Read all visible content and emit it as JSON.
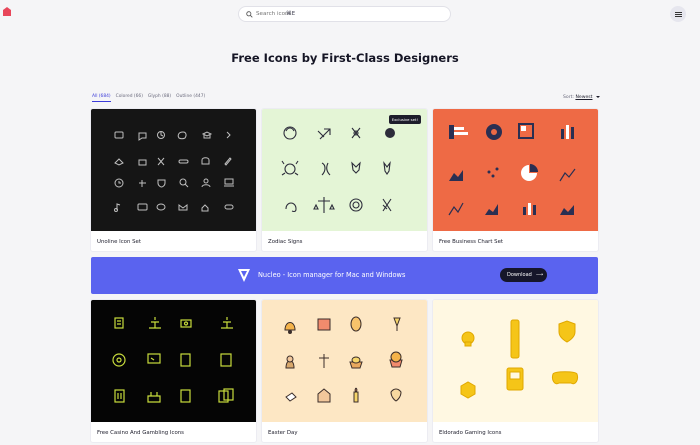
{
  "app": {
    "logo": "app-logo",
    "menu_icon": "menu-icon"
  },
  "search": {
    "placeholder": "Search icons",
    "shortcut": "⌘E",
    "icon": "search-icon"
  },
  "page": {
    "title": "Free Icons by First-Class Designers"
  },
  "filters": {
    "tabs": [
      {
        "label": "All (684)",
        "active": true
      },
      {
        "label": "Colored (66)",
        "active": false
      },
      {
        "label": "Glyph (88)",
        "active": false
      },
      {
        "label": "Outline (447)",
        "active": false
      }
    ],
    "sort_label": "Sort:",
    "sort_value": "Newest"
  },
  "cards": [
    {
      "label": "Unoline Icon Set",
      "bg": "#151515",
      "icon_color": "#bfbfbf"
    },
    {
      "label": "Zodiac Signs",
      "bg": "#e4f5d6",
      "icon_color": "#2c2c3a",
      "badge": "Exclusive set!"
    },
    {
      "label": "Free Business Chart Set",
      "bg": "#ee6a45",
      "icon_color": "#2a2f52"
    },
    {
      "label": "Free Casino And Gambling Icons",
      "bg": "#050505",
      "icon_color": "#c8dc3c"
    },
    {
      "label": "Easter Day",
      "bg": "#fde7c4",
      "icon_color": "#3a2d2a"
    },
    {
      "label": "Eldorado Gaming Icons",
      "bg": "#fff8e2",
      "icon_color": "#f5c518"
    }
  ],
  "banner": {
    "text": "Nucleo - Icon manager for Mac and Windows",
    "button": "Download",
    "bg": "#5a63ef",
    "icon": "nucleo-logo-icon"
  },
  "colors": {
    "accent": "#3b3bd9",
    "background": "#f5f5f7"
  }
}
